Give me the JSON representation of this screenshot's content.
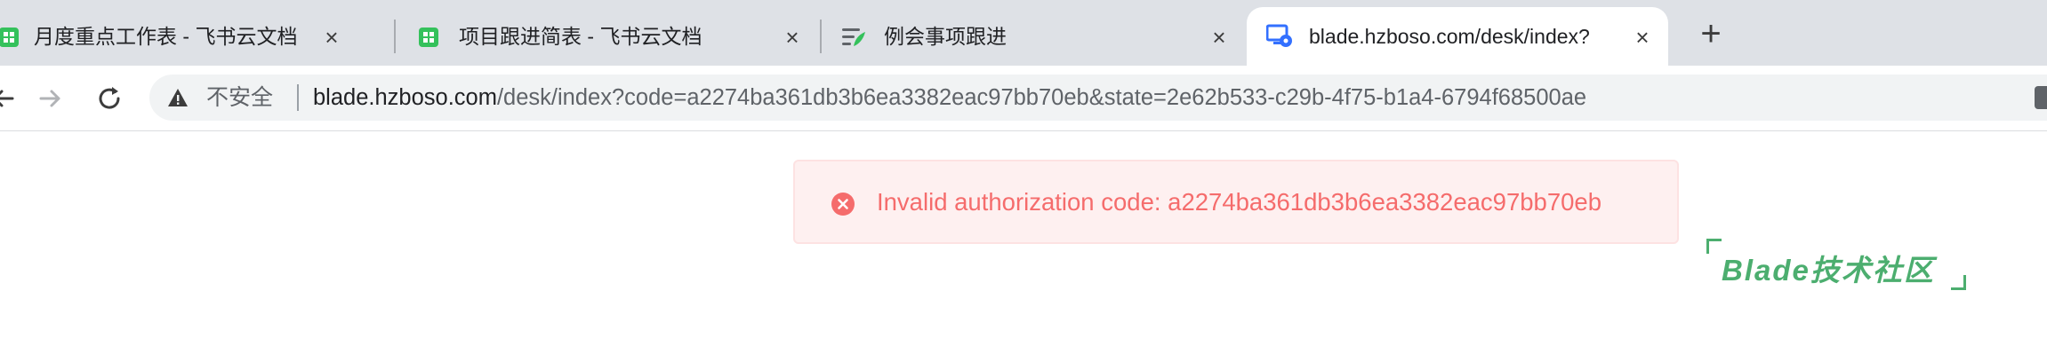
{
  "browser": {
    "tabs": [
      {
        "title": "月度重点工作表 - 飞书云文档",
        "icon": "sheet-icon",
        "active": false
      },
      {
        "title": "项目跟进简表 - 飞书云文档",
        "icon": "sheet-icon",
        "active": false
      },
      {
        "title": "例会事项跟进",
        "icon": "doc-icon",
        "active": false
      },
      {
        "title": "blade.hzboso.com/desk/index?",
        "icon": "desktop-gear-icon",
        "active": true
      }
    ],
    "close_glyph": "×",
    "new_tab_glyph": "+",
    "address_bar": {
      "security_label": "不安全",
      "url_host": "blade.hzboso.com",
      "url_path": "/desk/index?code=a2274ba361db3b6ea3382eac97bb70eb&state=2e62b533-c29b-4f75-b1a4-6794f68500ae"
    }
  },
  "page": {
    "alert": {
      "type": "error",
      "message": "Invalid authorization code: a2274ba361db3b6ea3382eac97bb70eb"
    },
    "logo_text": "Blade技术社区"
  },
  "colors": {
    "error_text": "#f56c6c",
    "error_bg": "#fef0f0",
    "brand_green": "#4cae6f",
    "sheet_green": "#34c15b",
    "favicon_blue": "#3370ff"
  }
}
